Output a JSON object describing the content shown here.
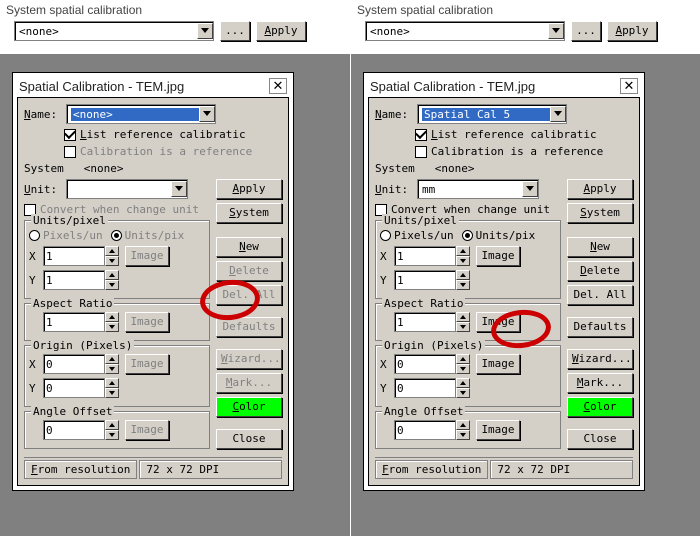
{
  "top": {
    "title": "System spatial calibration",
    "dropdown_value": "<none>",
    "ellipsis": "...",
    "apply": "Apply"
  },
  "dialog": {
    "title": "Spatial Calibration - TEM.jpg",
    "name_label": "Name:",
    "list_ref": "List reference calibratic",
    "cal_is_ref": "Calibration is a reference",
    "system_label": "System",
    "system_value": "<none>",
    "unit_label": "Unit:",
    "apply": "Apply",
    "convert": "Convert when change unit",
    "system_btn": "System",
    "units_per_pixel": {
      "legend": "Units/pixel",
      "pixels_per_un": "Pixels/un",
      "units_per_pix": "Units/pix",
      "x_label": "X",
      "y_label": "Y",
      "x_value": "1",
      "y_value": "1",
      "image": "Image"
    },
    "new_btn": "New",
    "delete_btn": "Delete",
    "del_all": "Del. All",
    "aspect": {
      "legend": "Aspect Ratio",
      "value": "1",
      "image": "Image"
    },
    "defaults": "Defaults",
    "origin": {
      "legend": "Origin (Pixels)",
      "x_label": "X",
      "y_label": "Y",
      "x_value": "0",
      "y_value": "0",
      "image": "Image"
    },
    "wizard": "Wizard...",
    "mark": "Mark...",
    "color": "Color",
    "angle": {
      "legend": "Angle Offset",
      "value": "0",
      "image": "Image"
    },
    "close": "Close",
    "status": {
      "from_res": "From resolution",
      "dpi": "72 x 72 DPI"
    }
  },
  "left": {
    "name_value": "<none>",
    "unit_value": ""
  },
  "right": {
    "name_value": "Spatial Cal 5",
    "unit_value": "mm"
  }
}
